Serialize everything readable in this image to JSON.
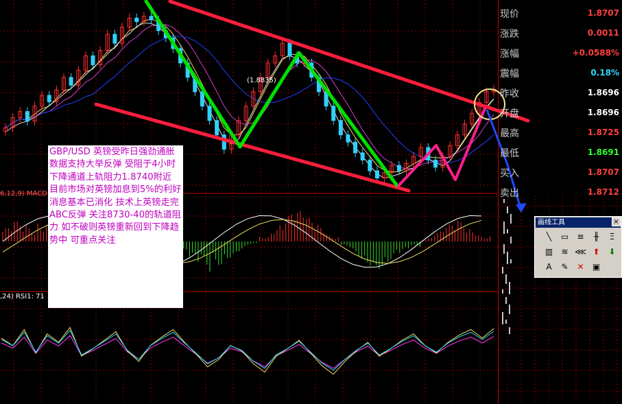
{
  "colors": {
    "background": "#000000",
    "grid": "#7a0000",
    "channel": "#ff1e3c",
    "abc_waves": "#00e000",
    "recent_waves": "#ff1e8c",
    "arrow": "#1f4aff",
    "circle": "#f0e68c",
    "up_candle": "#ff3030",
    "down_candle": "#30d0ff",
    "quote_red": "#ff4040",
    "quote_green": "#30ff30",
    "quote_cyan": "#30d8ff",
    "quote_white": "#ffffff",
    "note_text": "#c000c0"
  },
  "quote_panel": [
    {
      "label": "现价",
      "value": "1.8707",
      "color": "red"
    },
    {
      "label": "涨跌",
      "value": "0.0011",
      "color": "red"
    },
    {
      "label": "涨幅",
      "value": "+0.0588%",
      "color": "red"
    },
    {
      "label": "震幅",
      "value": "0.18%",
      "color": "cyan"
    },
    {
      "label": "昨收",
      "value": "1.8696",
      "color": "white"
    },
    {
      "label": "开盘",
      "value": "1.8696",
      "color": "white"
    },
    {
      "label": "最高",
      "value": "1.8725",
      "color": "red"
    },
    {
      "label": "最低",
      "value": "1.8691",
      "color": "green"
    },
    {
      "label": "买入",
      "value": "1.8707",
      "color": "red"
    },
    {
      "label": "卖出",
      "value": "1.8712",
      "color": "red"
    }
  ],
  "price_annotation": "(1.8835)",
  "note": "GBP/USD  英镑受昨日强劲通胀数据支持大举反弹 受阻于4小时下降通道上轨阻力1.8740附近 目前市场对英镑加息到5%的利好消息基本已消化 技术上英镑走完ABC反弹 关注8730-40的轨道阻力 如不破则英镑重新回到下降趋势中 可重点关注",
  "macd_label": "6,12,9) MACD",
  "rsi_label": ",24) RSI1: 71",
  "toolbox": {
    "title": "画线工具",
    "close": "×",
    "buttons": [
      {
        "glyph": "╲",
        "name": "line-tool-icon"
      },
      {
        "glyph": "▭",
        "name": "rect-tool-icon"
      },
      {
        "glyph": "≡",
        "name": "parallel-tool-icon"
      },
      {
        "glyph": "╫",
        "name": "gann-tool-icon"
      },
      {
        "glyph": "Ξ",
        "name": "level-tool-icon"
      },
      {
        "glyph": "▥",
        "name": "fib-time-icon"
      },
      {
        "glyph": "≋",
        "name": "cycle-tool-icon"
      },
      {
        "glyph": "⋘",
        "name": "fan-tool-icon"
      },
      {
        "glyph": "⬆",
        "name": "up-arrow-tool-icon",
        "color": "#e00000"
      },
      {
        "glyph": "⬇",
        "name": "down-arrow-tool-icon",
        "color": "#008000"
      },
      {
        "glyph": "A",
        "name": "text-tool-icon"
      },
      {
        "glyph": "✎",
        "name": "eraser-tool-icon"
      },
      {
        "glyph": "✕",
        "name": "delete-tool-icon",
        "color": "#e00000"
      },
      {
        "glyph": "▣",
        "name": "save-tool-icon"
      }
    ]
  },
  "chart_data": {
    "type": "candlestick",
    "symbol": "GBP/USD",
    "marked_high": 1.8835,
    "price_levels": {
      "last": 1.8707,
      "prev_close": 1.8696,
      "open": 1.8696,
      "high": 1.8725,
      "low": 1.8691,
      "bid": 1.8707,
      "ask": 1.8712
    },
    "closes": [
      1.86,
      1.8628,
      1.8645,
      1.8618,
      1.866,
      1.869,
      1.8672,
      1.8705,
      1.874,
      1.8718,
      1.876,
      1.88,
      1.8775,
      1.8815,
      1.886,
      1.8835,
      1.888,
      1.8905,
      1.8895,
      1.891,
      1.89,
      1.887,
      1.885,
      1.882,
      1.878,
      1.874,
      1.87,
      1.866,
      1.862,
      1.858,
      1.854,
      1.858,
      1.862,
      1.866,
      1.87,
      1.874,
      1.878,
      1.88,
      1.8835,
      1.88,
      1.878,
      1.878,
      1.874,
      1.87,
      1.866,
      1.862,
      1.858,
      1.856,
      1.853,
      1.851,
      1.848,
      1.846,
      1.8475,
      1.8495,
      1.848,
      1.85,
      1.852,
      1.8545,
      1.851,
      1.849,
      1.852,
      1.855,
      1.858,
      1.861,
      1.864,
      1.867,
      1.87,
      1.8707
    ],
    "moving_averages": [
      "yellow",
      "magenta",
      "blue",
      "white"
    ],
    "macd_histogram": [
      0.4,
      0.6,
      0.5,
      0.7,
      0.3,
      0.2,
      -0.1,
      -0.3,
      0.1,
      0.3,
      0.5,
      0.6,
      0.4,
      0.2,
      -0.2,
      -0.5,
      -0.8,
      -0.9,
      -0.7,
      -0.5,
      -0.3,
      -0.1,
      0.2,
      0.5,
      0.8,
      0.9,
      0.7,
      0.5,
      0.2,
      -0.2,
      -0.5,
      -0.7,
      -0.8,
      -0.6,
      -0.4,
      -0.2,
      0.1,
      0.3,
      0.5,
      0.6,
      0.4,
      0.2
    ],
    "rsi": [
      62,
      55,
      70,
      48,
      66,
      58,
      72,
      45,
      52,
      60,
      68,
      50,
      40,
      55,
      63,
      70,
      58,
      47,
      35,
      42,
      55,
      50,
      38,
      30,
      45,
      52,
      60,
      48,
      36,
      28,
      40,
      50,
      58,
      45,
      52,
      60,
      66,
      55,
      48,
      58,
      65,
      70,
      62,
      71
    ]
  }
}
